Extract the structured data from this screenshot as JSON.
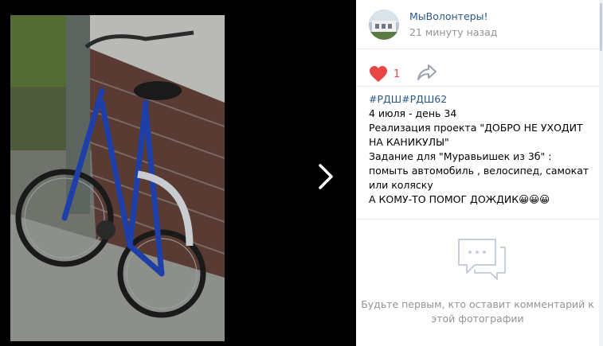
{
  "post": {
    "author": "МыВолонтеры!",
    "time": "21 минуту назад",
    "likes": "1",
    "hashtags": [
      "#РДШ",
      "#РДШ62"
    ],
    "lines": [
      "4 июля - день 34",
      "Реализация проекта \"ДОБРО НЕ УХОДИТ НА КАНИКУЛЫ\"",
      "Задание для \"Муравьишек из 3б\" : помыть автомобиль , велосипед, самокат или коляску",
      "А КОМУ-ТО ПОМОГ ДОЖДИК😀😀😀"
    ]
  },
  "comments": {
    "empty_text": "Будьте первым, кто оставит комментарий к этой фотографии"
  },
  "icons": {
    "next": "chevron-right-icon",
    "like": "heart-icon",
    "share": "share-icon",
    "comments": "comment-bubble-icon"
  },
  "colors": {
    "link": "#2a5885",
    "like": "#e64646",
    "muted": "#939393"
  }
}
